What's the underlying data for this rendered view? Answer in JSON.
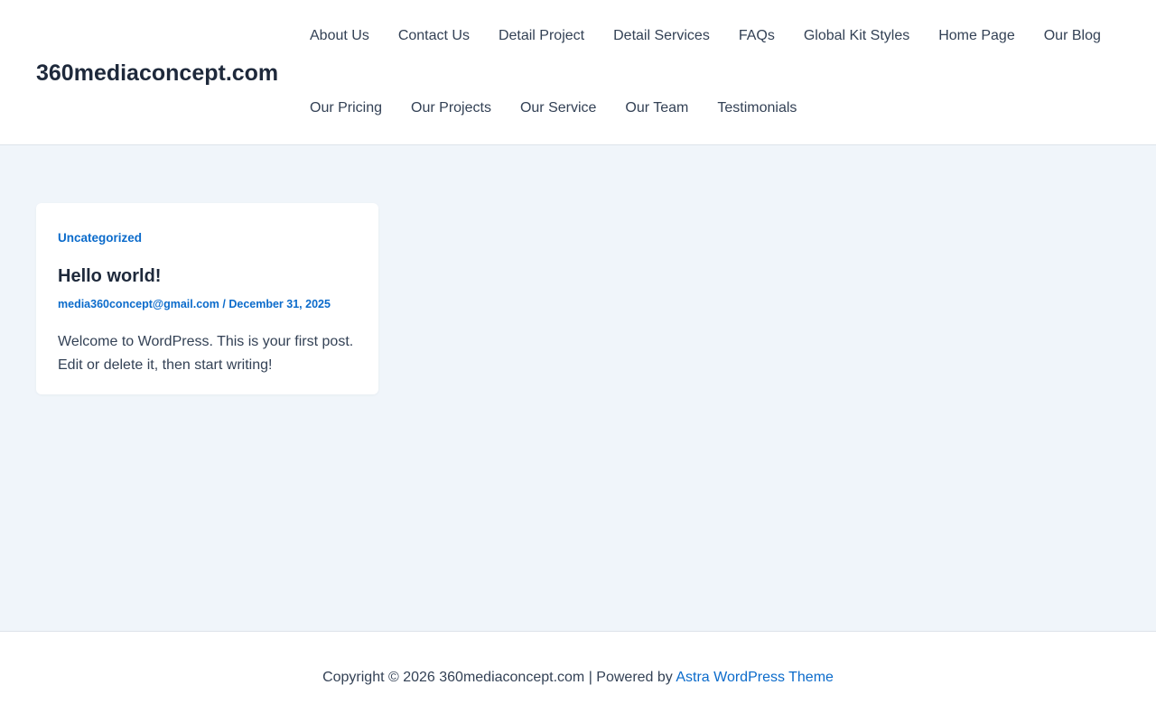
{
  "header": {
    "site_title": "360mediaconcept.com",
    "nav_row1": [
      "About Us",
      "Contact Us",
      "Detail Project",
      "Detail Services",
      "FAQs",
      "Global Kit Styles",
      "Home Page",
      "Our Blog"
    ],
    "nav_row2": [
      "Our Pricing",
      "Our Projects",
      "Our Service",
      "Our Team",
      "Testimonials"
    ]
  },
  "post": {
    "category": "Uncategorized",
    "title": "Hello world!",
    "author": "media360concept@gmail.com",
    "separator": " / ",
    "date": "December 31, 2025",
    "excerpt": "Welcome to WordPress. This is your first post. Edit or delete it, then start writing!"
  },
  "footer": {
    "copyright": "Copyright © 2026 360mediaconcept.com | Powered by ",
    "theme_link": "Astra WordPress Theme"
  },
  "colors": {
    "accent": "#0b6bcb",
    "content_background": "#f0f5fa",
    "heading": "#1e293b",
    "text": "#334155"
  }
}
